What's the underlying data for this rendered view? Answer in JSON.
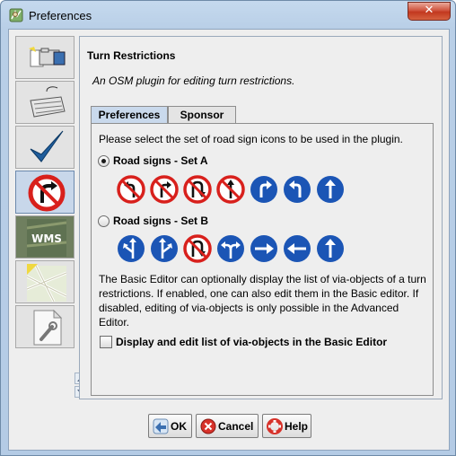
{
  "window": {
    "title": "Preferences",
    "close_symbol": "✕"
  },
  "sidebar": {
    "tabs": [
      {
        "name": "display-settings",
        "icon": "folder-icon"
      },
      {
        "name": "keyboard-shortcuts",
        "icon": "keyboard-icon"
      },
      {
        "name": "validator",
        "icon": "checkmark-icon"
      },
      {
        "name": "turn-restrictions",
        "icon": "no-turn-sign-icon",
        "selected": true
      },
      {
        "name": "wms",
        "icon": "wms-icon",
        "label": "WMS"
      },
      {
        "name": "map-imagery",
        "icon": "map-icon"
      },
      {
        "name": "advanced",
        "icon": "document-wrench-icon"
      }
    ]
  },
  "panel": {
    "title": "Turn Restrictions",
    "description": "An OSM plugin for editing turn restrictions.",
    "tabs": [
      {
        "label": "Preferences",
        "active": true
      },
      {
        "label": "Sponsor",
        "active": false
      }
    ],
    "prompt": "Please select the set of road sign icons to be used in the plugin.",
    "option_a": {
      "label": "Road signs - Set A",
      "checked": true
    },
    "option_b": {
      "label": "Road signs - Set B",
      "checked": false
    },
    "set_a_signs": [
      "no-left-turn-icon",
      "no-right-turn-icon",
      "no-u-turn-icon",
      "no-straight-on-icon",
      "only-right-turn-icon",
      "only-left-turn-icon",
      "only-straight-on-icon"
    ],
    "set_b_signs": [
      "only-left-turn-icon",
      "only-right-turn-icon",
      "no-u-turn-icon",
      "only-left-or-right-icon",
      "only-right-icon",
      "only-left-icon",
      "only-straight-on-icon"
    ],
    "info_text": "The Basic Editor can optionally display the list of via-objects of a turn restrictions. If enabled, one can also edit them in the Basic editor. If disabled, editing of via-objects is only possible in the Advanced Editor.",
    "via_checkbox": {
      "label": "Display and edit list of via-objects in the Basic Editor",
      "checked": false
    }
  },
  "buttons": {
    "ok": "OK",
    "cancel": "Cancel",
    "help": "Help"
  },
  "colors": {
    "prohibition_red": "#d8201c",
    "mandatory_blue": "#1b55b5",
    "selection_blue": "#c8d7ea"
  }
}
